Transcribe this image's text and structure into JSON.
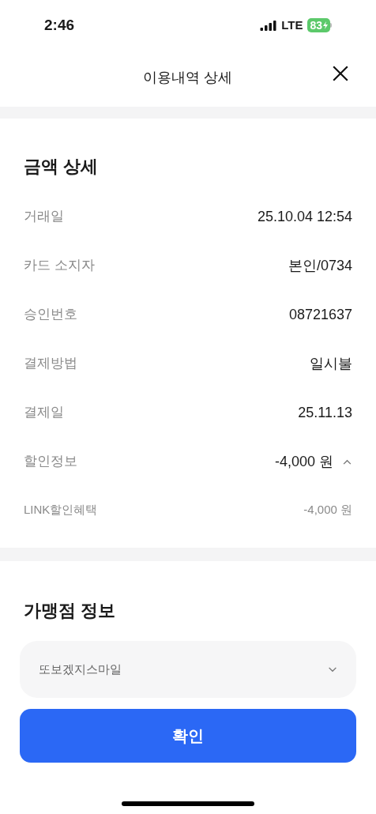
{
  "status_bar": {
    "time": "2:46",
    "network": "LTE",
    "battery": "83"
  },
  "header": {
    "title": "이용내역 상세"
  },
  "amount_section": {
    "title": "금액 상세",
    "rows": [
      {
        "label": "거래일",
        "value": "25.10.04 12:54"
      },
      {
        "label": "카드 소지자",
        "value": "본인/0734"
      },
      {
        "label": "승인번호",
        "value": "08721637"
      },
      {
        "label": "결제방법",
        "value": "일시불"
      },
      {
        "label": "결제일",
        "value": "25.11.13"
      },
      {
        "label": "할인정보",
        "value": "-4,000 원",
        "expanded": true,
        "children": [
          {
            "label": "LINK할인혜택",
            "value": "-4,000 원"
          }
        ]
      }
    ]
  },
  "merchant_section": {
    "title": "가맹점 정보",
    "dropdown": {
      "value": "또보겠지스마일",
      "expanded": false
    }
  },
  "confirm_button": "확인"
}
